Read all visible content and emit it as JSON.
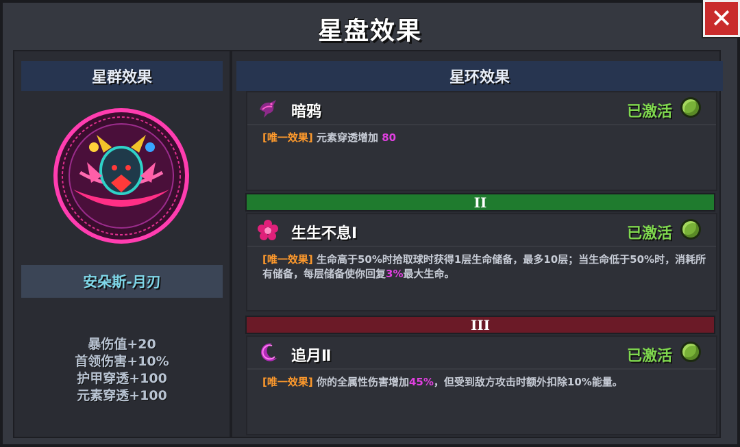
{
  "window": {
    "title": "星盘效果",
    "close_label": "✕"
  },
  "left": {
    "header": "星群效果",
    "constellation_name": "安朵斯-月刃",
    "stats": [
      "暴伤值+20",
      "首领伤害+10%",
      "护甲穿透+100",
      "元素穿透+100"
    ]
  },
  "right": {
    "header": "星环效果",
    "sections": [
      {
        "name": "暗鸦",
        "status": "已激活",
        "tag": "[唯一效果]",
        "desc_parts": [
          "元素穿透增加 ",
          "80",
          ""
        ],
        "icon": "crow-icon"
      },
      {
        "divider": "II",
        "name": "生生不息Ⅰ",
        "status": "已激活",
        "tag": "[唯一效果]",
        "desc_parts": [
          "生命高于50%时拾取球时获得1层生命储备，最多10层；当生命低于50%时，消耗所有储备，每层储备使你回复",
          "3%",
          "最大生命。"
        ],
        "icon": "flower-icon"
      },
      {
        "divider": "III",
        "name": "追月Ⅱ",
        "status": "已激活",
        "tag": "[唯一效果]",
        "desc_parts": [
          "你的全属性伤害增加",
          "45%",
          "，但受到敌方攻击时额外扣除10%能量。"
        ],
        "icon": "moon-icon"
      }
    ]
  },
  "colors": {
    "active": "#7fd84e",
    "tag": "#ff9a2c",
    "highlight": "#e040e0",
    "divider_green": "#1f7b2e",
    "divider_red": "#6b1a27"
  }
}
